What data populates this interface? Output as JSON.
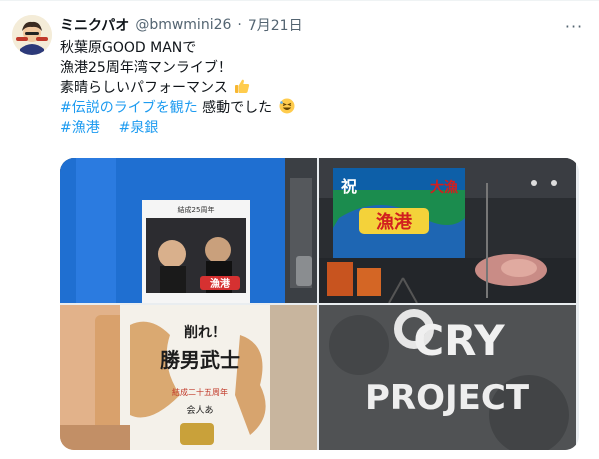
{
  "tweet": {
    "display_name": "ミニクパオ",
    "handle": "@bmwmini26",
    "separator": "·",
    "date": "7月21日",
    "more_label": "···",
    "lines": [
      {
        "text": "秋葉原GOOD MANで"
      },
      {
        "text": "漁港25周年湾マンライブ！"
      },
      {
        "text": "素晴らしいパフォーマンス"
      },
      {
        "hashtag": "#伝説のライブを観た",
        "text": " 感動でした"
      },
      {
        "hashtag1": "#漁港",
        "hashtag2": "#泉銀"
      }
    ],
    "emojis": [
      "thumbs-up-icon",
      "grinning-squint-face-icon"
    ]
  },
  "media": {
    "photo1": {
      "poster_header": "結成25周年",
      "poster_logo": "漁港"
    },
    "photo2": {
      "banner_big": "大漁",
      "banner_left": "祝",
      "banner_logo": "漁港"
    },
    "photo3": {
      "package_text": "削れ！",
      "package_main": "勝男武士",
      "package_side": "結成二十五周年",
      "package_small": "会人あ"
    },
    "photo4": {
      "sign_line1": "CRY",
      "sign_line2": "PROJECT"
    }
  },
  "colors": {
    "link": "#1d9bf0",
    "muted": "#536471"
  }
}
